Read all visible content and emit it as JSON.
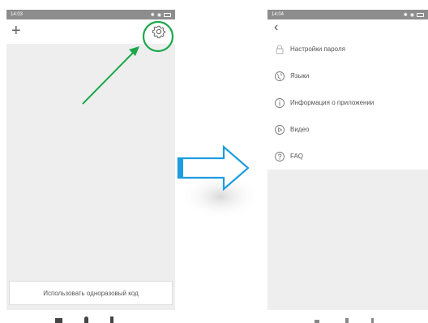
{
  "left_screen": {
    "status": {
      "time": "14:03"
    },
    "toolbar": {
      "add_icon": "plus-icon",
      "settings_icon": "gear-icon"
    },
    "bottom_button": {
      "label": "Использовать одноразовый код"
    }
  },
  "right_screen": {
    "status": {
      "time": "14:04"
    },
    "back_icon": "chevron-left-icon",
    "menu": [
      {
        "label": "Настройки пароля",
        "icon": "lock-icon"
      },
      {
        "label": "Языки",
        "icon": "globe-icon"
      },
      {
        "label": "Информация о приложении",
        "icon": "info-icon"
      },
      {
        "label": "Видео",
        "icon": "play-icon"
      },
      {
        "label": "FAQ",
        "icon": "question-icon"
      }
    ]
  },
  "annotation": {
    "highlight_color": "#1aa84a",
    "transition_arrow_color": "#1e9ce0"
  }
}
